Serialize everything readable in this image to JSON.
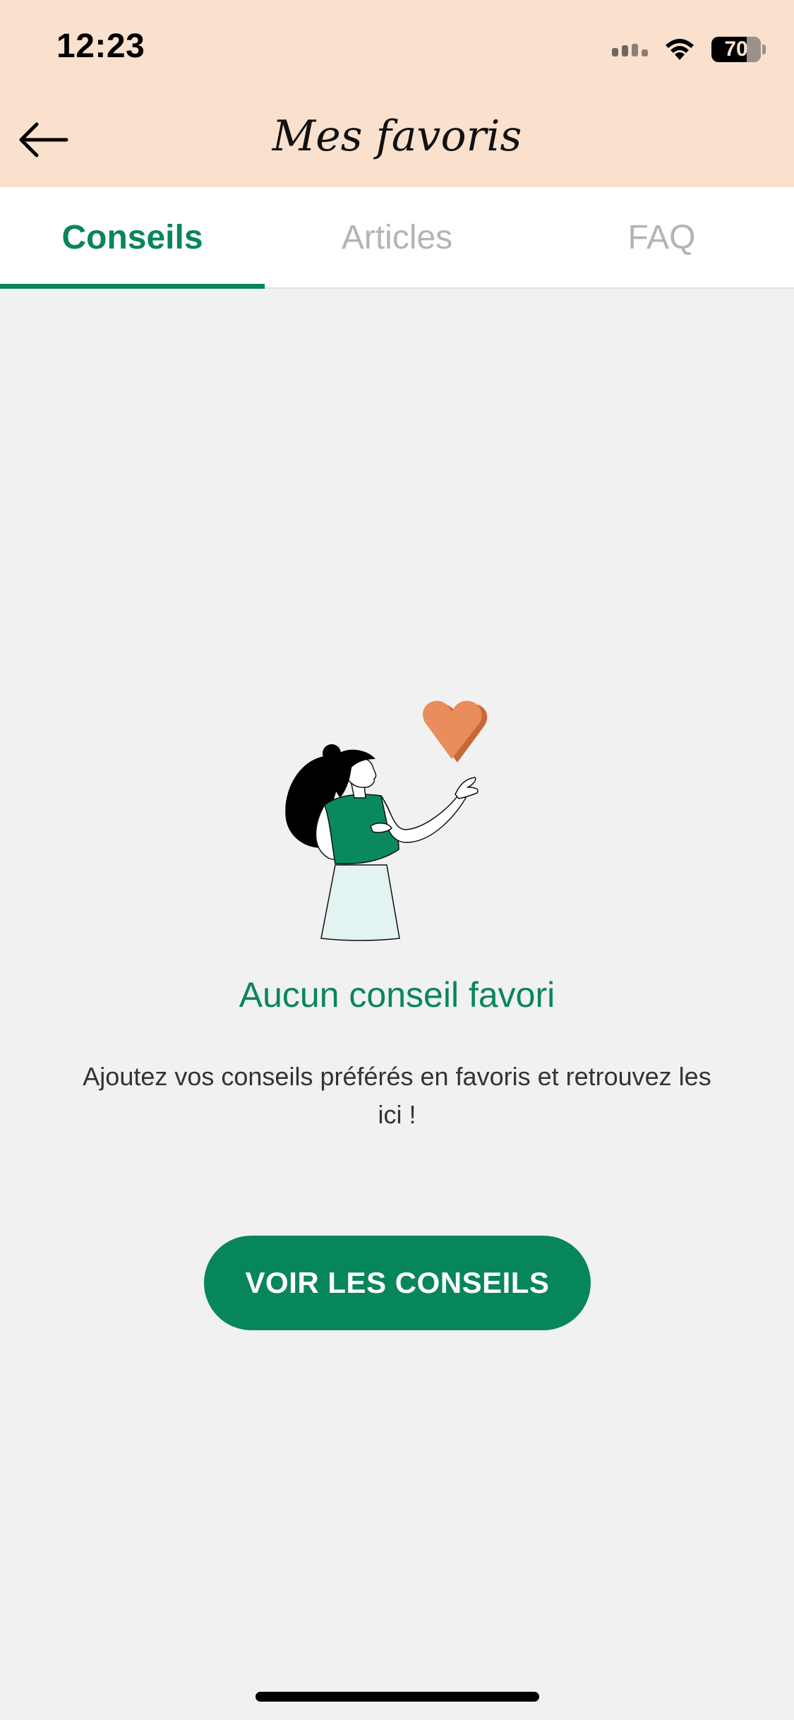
{
  "status_bar": {
    "time": "12:23",
    "battery": "70"
  },
  "header": {
    "title": "Mes favoris",
    "back_icon": "arrow-left-icon"
  },
  "tabs": [
    {
      "label": "Conseils",
      "active": true
    },
    {
      "label": "Articles",
      "active": false
    },
    {
      "label": "FAQ",
      "active": false
    }
  ],
  "empty_state": {
    "title": "Aucun conseil favori",
    "text": "Ajoutez vos conseils préférés en favoris et retrouvez les ici !",
    "button_label": "VOIR LES CONSEILS",
    "illustration": "woman-holding-heart-illustration"
  },
  "colors": {
    "header_bg": "#f9e1cd",
    "accent": "#08865b",
    "heart": "#e88d5b",
    "background": "#f1f1f1"
  }
}
